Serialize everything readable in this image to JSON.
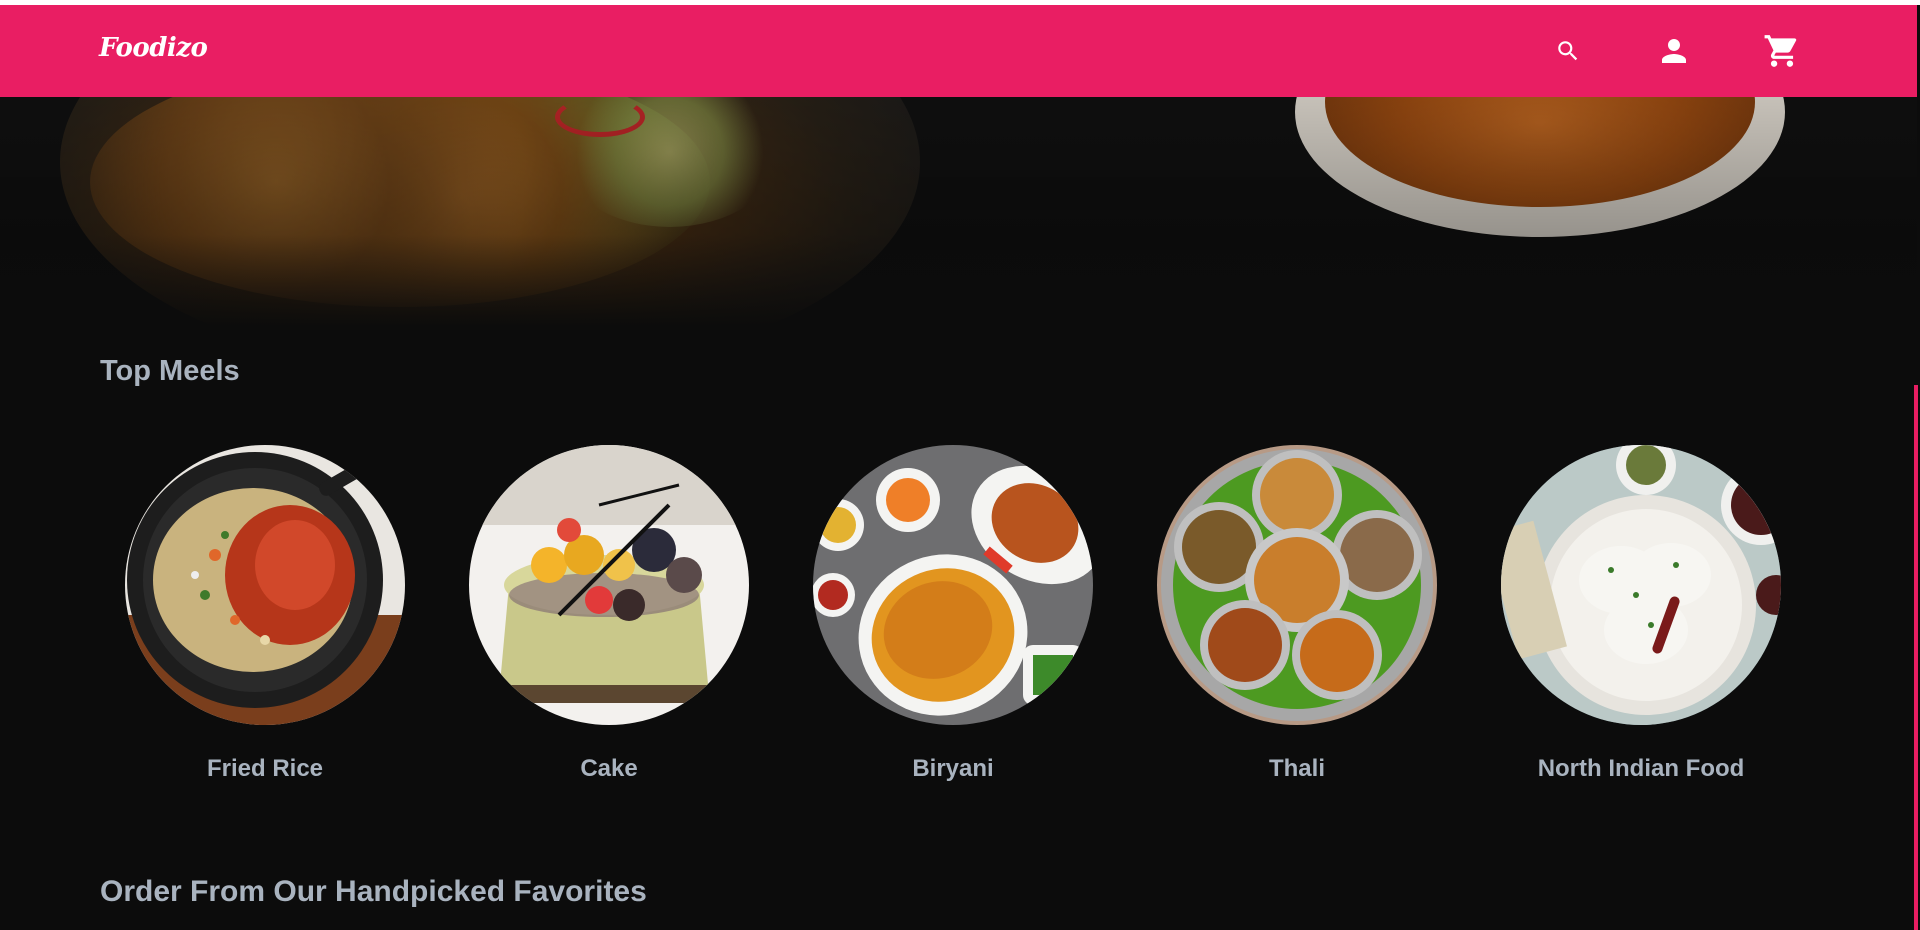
{
  "navbar": {
    "brand": "Foodizo",
    "icons": [
      "search-icon",
      "account-icon",
      "cart-icon"
    ],
    "bg_color": "#e91e63"
  },
  "sections": {
    "top_meals_title": "Top Meels",
    "favorites_title": "Order From Our Handpicked Favorites"
  },
  "meals": [
    {
      "label": "Fried Rice"
    },
    {
      "label": "Cake"
    },
    {
      "label": "Biryani"
    },
    {
      "label": "Thali"
    },
    {
      "label": "North Indian Food"
    }
  ],
  "colors": {
    "accent": "#e91e63",
    "background": "#0c0c0c",
    "text": "#a9b3bf"
  }
}
